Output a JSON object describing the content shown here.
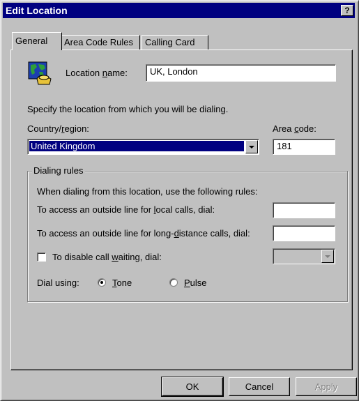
{
  "window": {
    "title": "Edit Location",
    "help_label": "?"
  },
  "tabs": [
    {
      "label": "General",
      "active": true
    },
    {
      "label": "Area Code Rules",
      "active": false
    },
    {
      "label": "Calling Card",
      "active": false
    }
  ],
  "general": {
    "location_icon": "location-globe-phone-icon",
    "location_name_label_pre": "Location ",
    "location_name_label_mnemonic": "n",
    "location_name_label_post": "ame:",
    "location_name_value": "UK, London",
    "specify_text": "Specify the location from which you will be dialing.",
    "country_label_pre": "Country/",
    "country_label_mnemonic": "r",
    "country_label_post": "egion:",
    "country_value": "United Kingdom",
    "area_code_label_pre": "Area ",
    "area_code_label_mnemonic": "c",
    "area_code_label_post": "ode:",
    "area_code_value": "181"
  },
  "dialing_rules": {
    "group_label": "Dialing rules",
    "intro": "When dialing from this location, use the following rules:",
    "local_label_pre": "To access an outside line for ",
    "local_label_mnemonic": "l",
    "local_label_post": "ocal calls, dial:",
    "local_value": "",
    "long_label_pre": "To access an outside line for long-",
    "long_label_mnemonic": "d",
    "long_label_post": "istance calls, dial:",
    "long_value": "",
    "call_waiting_label_pre": "To disable call ",
    "call_waiting_label_mnemonic": "w",
    "call_waiting_label_post": "aiting, dial:",
    "call_waiting_checked": false,
    "dial_using_label": "Dial using:",
    "tone_mnemonic": "T",
    "tone_rest": "one",
    "pulse_mnemonic": "P",
    "pulse_rest": "ulse",
    "selected": "Tone"
  },
  "buttons": {
    "ok": "OK",
    "cancel": "Cancel",
    "apply": "Apply"
  },
  "colors": {
    "titlebar": "#000080",
    "face": "#c0c0c0",
    "selection": "#000080"
  }
}
